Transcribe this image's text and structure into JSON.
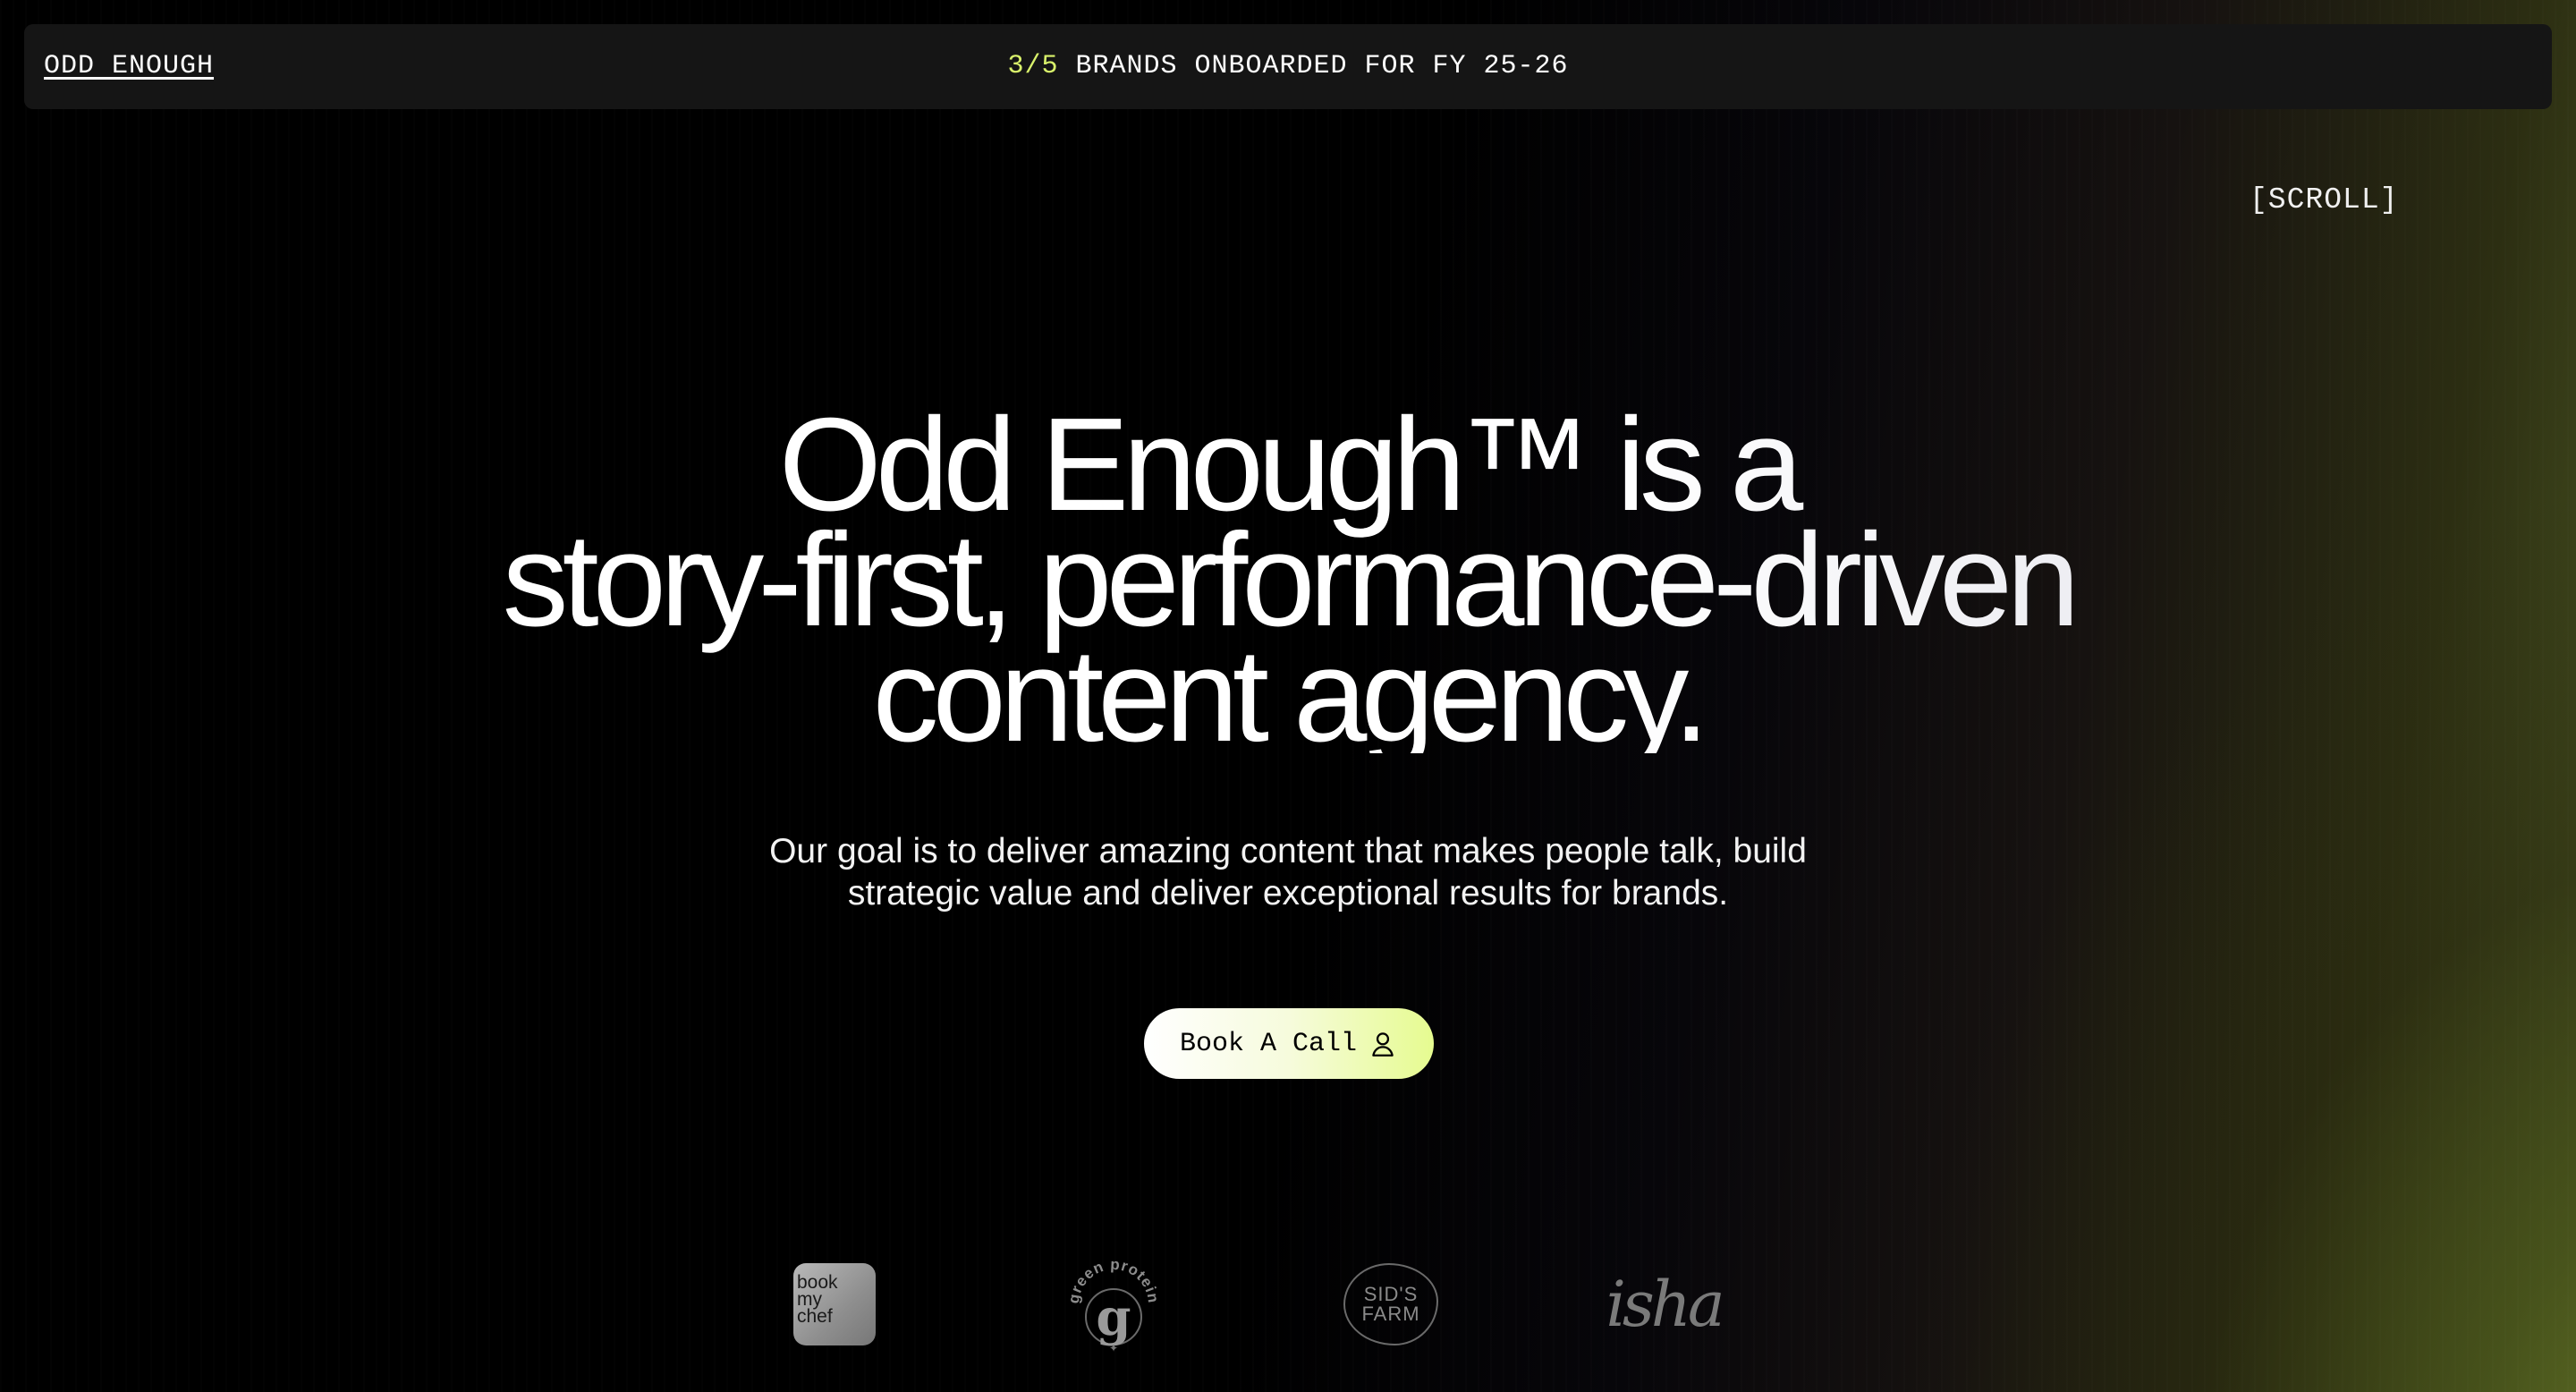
{
  "header": {
    "logo_label": "ODD ENOUGH",
    "ticker_count": "3/5",
    "ticker_text": " BRANDS ONBOARDED FOR FY 25-26"
  },
  "scroll_hint": "[SCROLL]",
  "hero": {
    "headline_line1": "Odd Enough™ is a",
    "headline_line2": "story-first, performance-driven",
    "headline_line3": "content agency.",
    "subcopy_line1": "Our goal is to deliver amazing content that makes people talk, build",
    "subcopy_line2": "strategic value and deliver exceptional results for brands."
  },
  "cta": {
    "label": "Book A Call",
    "icon": "user-icon"
  },
  "brands": [
    {
      "name": "book my chef",
      "lines": [
        "book",
        "my",
        "chef"
      ]
    },
    {
      "name": "green protein",
      "text": "green protein",
      "mark": "g"
    },
    {
      "name": "Sid's Farm",
      "lines": [
        "SID'S",
        "FARM"
      ]
    },
    {
      "name": "isha",
      "text": "isha"
    }
  ],
  "colors": {
    "accent_green": "#d9f26b",
    "topbar_bg": "#151515",
    "background": "#000000"
  }
}
